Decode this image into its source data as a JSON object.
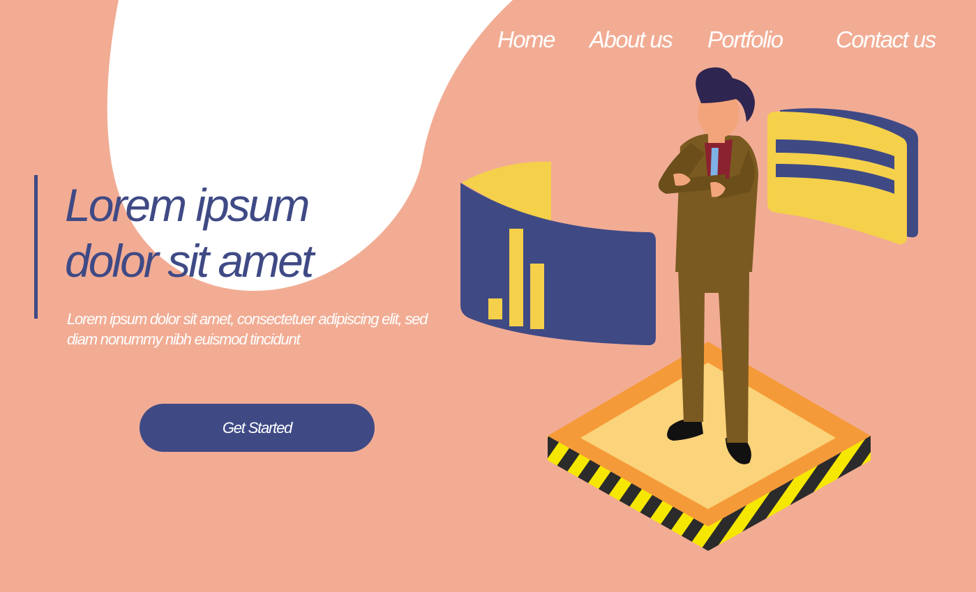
{
  "nav": {
    "items": [
      {
        "label": "Home"
      },
      {
        "label": "About us"
      },
      {
        "label": "Portfolio"
      },
      {
        "label": "Contact us"
      }
    ]
  },
  "hero": {
    "title_line1": "Lorem ipsum",
    "title_line2": "dolor sit amet",
    "body": "Lorem ipsum dolor sit amet, consectetuer adipiscing elit, sed diam nonummy nibh euismod tincidunt",
    "cta_label": "Get Started"
  },
  "colors": {
    "background": "#f2ac94",
    "accent_navy": "#3f4a85",
    "yellow": "#f5d04a",
    "suit": "#7a5a20",
    "platform_orange": "#f59a38"
  },
  "illustration": {
    "icons": [
      "businessman-figure",
      "bar-chart-panel-icon",
      "text-lines-panel-icon",
      "hazard-platform"
    ]
  }
}
